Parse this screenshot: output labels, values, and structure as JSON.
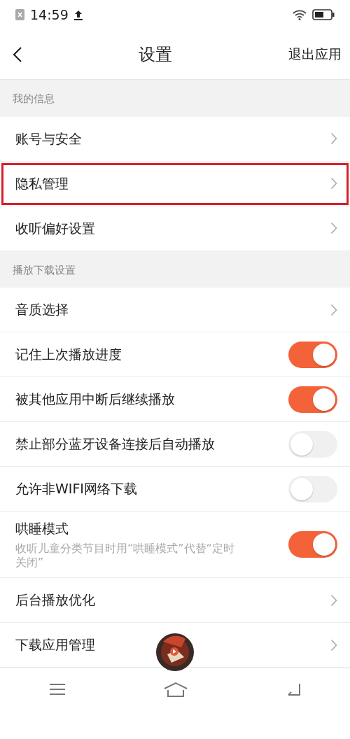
{
  "status_bar": {
    "time": "14:59"
  },
  "header": {
    "title": "设置",
    "action": "退出应用"
  },
  "sections": [
    {
      "title": "我的信息",
      "items": [
        {
          "kind": "link",
          "label": "账号与安全",
          "highlighted": false
        },
        {
          "kind": "link",
          "label": "隐私管理",
          "highlighted": true
        },
        {
          "kind": "link",
          "label": "收听偏好设置",
          "highlighted": false
        }
      ]
    },
    {
      "title": "播放下载设置",
      "items": [
        {
          "kind": "link",
          "label": "音质选择",
          "highlighted": false
        },
        {
          "kind": "toggle",
          "label": "记住上次播放进度",
          "on": true
        },
        {
          "kind": "toggle",
          "label": "被其他应用中断后继续播放",
          "on": true
        },
        {
          "kind": "toggle",
          "label": "禁止部分蓝牙设备连接后自动播放",
          "on": false
        },
        {
          "kind": "toggle",
          "label": "允许非WIFI网络下载",
          "on": false
        },
        {
          "kind": "toggle",
          "label": "哄睡模式",
          "description": "收听儿童分类节目时用“哄睡模式”代替“定时关闭”",
          "on": true
        },
        {
          "kind": "link",
          "label": "后台播放优化",
          "highlighted": false
        },
        {
          "kind": "link",
          "label": "下载应用管理",
          "highlighted": false
        }
      ]
    }
  ]
}
